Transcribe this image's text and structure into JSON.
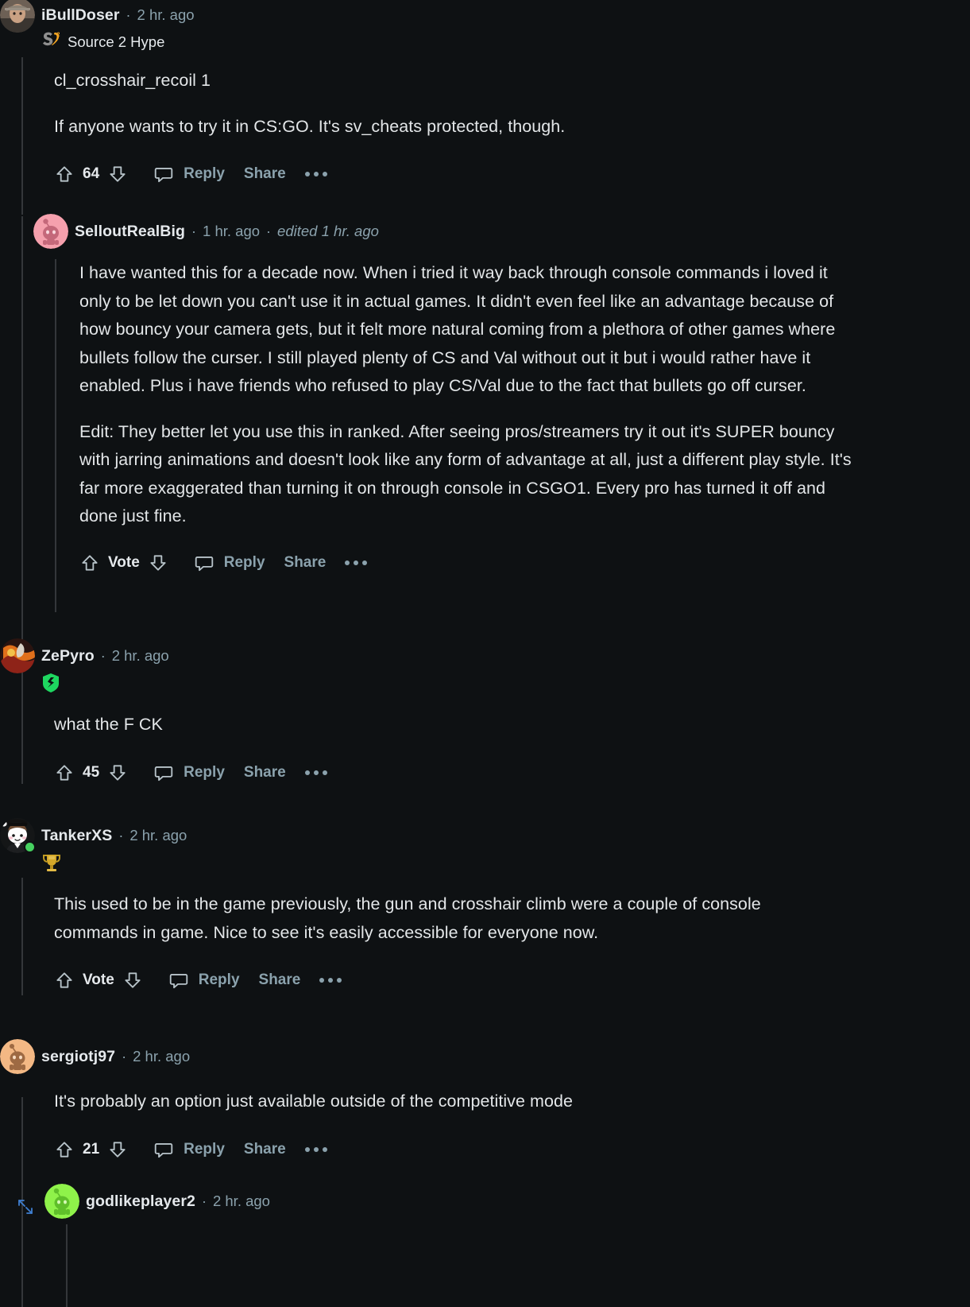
{
  "theme": {
    "background": "#0e1113",
    "text_primary": "#e3e6e8",
    "text_muted": "#8ba2ad",
    "rail": "#34373a",
    "flair_green": "#1ed760",
    "flair_gold": "#d4a829",
    "online_green": "#46d160",
    "expand_blue": "#3f7fd1"
  },
  "comments": [
    {
      "id": "c1",
      "author": "iBullDoser",
      "timestamp": "2 hr. ago",
      "separator": "·",
      "flair": {
        "text": "Source 2 Hype",
        "icon": "source2-logo-icon"
      },
      "avatar": {
        "name": "user-avatar-ibulldoser",
        "type": "photo"
      },
      "paragraphs": [
        "cl_crosshair_recoil 1",
        "If anyone wants to try it in CS:GO. It's sv_cheats protected, though."
      ],
      "actions": {
        "upvote_icon": "upvote-arrow-icon",
        "score": "64",
        "downvote_icon": "downvote-arrow-icon",
        "comment_icon": "comment-bubble-icon",
        "reply_label": "Reply",
        "share_label": "Share",
        "more_icon": "more-options-icon"
      }
    },
    {
      "id": "c2",
      "author": "SelloutRealBig",
      "timestamp": "1 hr. ago",
      "separator": "·",
      "edited": "edited 1 hr. ago",
      "avatar": {
        "name": "user-avatar-selloutrealbig",
        "type": "snoo-pink"
      },
      "paragraphs": [
        "I have wanted this for a decade now. When i tried it way back through console commands i loved it only to be let down you can't use it in actual games. It didn't even feel like an advantage because of how bouncy your camera gets, but it felt more natural coming from a plethora of other games where bullets follow the curser. I still played plenty of CS and Val without out it but i would rather have it enabled. Plus i have friends who refused to play CS/Val due to the fact that bullets go off curser.",
        "Edit: They better let you use this in ranked. After seeing pros/streamers try it out it's SUPER bouncy with jarring animations and doesn't look like any form of advantage at all, just a different play style. It's far more exaggerated than turning it on through console in CSGO1. Every pro has turned it off and done just fine."
      ],
      "actions": {
        "upvote_icon": "upvote-arrow-icon",
        "score": "Vote",
        "downvote_icon": "downvote-arrow-icon",
        "comment_icon": "comment-bubble-icon",
        "reply_label": "Reply",
        "share_label": "Share",
        "more_icon": "more-options-icon"
      }
    },
    {
      "id": "c3",
      "author": "ZePyro",
      "timestamp": "2 hr. ago",
      "separator": "·",
      "flair": {
        "text": "",
        "icon": "green-shield-badge-icon"
      },
      "avatar": {
        "name": "user-avatar-zepyro",
        "type": "photo-red"
      },
      "paragraphs": [
        "what the F  CK"
      ],
      "actions": {
        "upvote_icon": "upvote-arrow-icon",
        "score": "45",
        "downvote_icon": "downvote-arrow-icon",
        "comment_icon": "comment-bubble-icon",
        "reply_label": "Reply",
        "share_label": "Share",
        "more_icon": "more-options-icon"
      }
    },
    {
      "id": "c4",
      "author": "TankerXS",
      "timestamp": "2 hr. ago",
      "separator": "·",
      "flair": {
        "text": "",
        "icon": "gold-trophy-badge-icon"
      },
      "avatar": {
        "name": "user-avatar-tankerxs",
        "type": "snoo-cartoon",
        "online": true
      },
      "paragraphs": [
        "This used to be in the game previously, the gun and crosshair climb were a couple of console commands in game. Nice to see it's easily accessible for everyone now."
      ],
      "actions": {
        "upvote_icon": "upvote-arrow-icon",
        "score": "Vote",
        "downvote_icon": "downvote-arrow-icon",
        "comment_icon": "comment-bubble-icon",
        "reply_label": "Reply",
        "share_label": "Share",
        "more_icon": "more-options-icon"
      }
    },
    {
      "id": "c5",
      "author": "sergiotj97",
      "timestamp": "2 hr. ago",
      "separator": "·",
      "avatar": {
        "name": "user-avatar-sergiotj97",
        "type": "snoo-orange"
      },
      "paragraphs": [
        "It's probably an option just available outside of the competitive mode"
      ],
      "actions": {
        "upvote_icon": "upvote-arrow-icon",
        "score": "21",
        "downvote_icon": "downvote-arrow-icon",
        "comment_icon": "comment-bubble-icon",
        "reply_label": "Reply",
        "share_label": "Share",
        "more_icon": "more-options-icon"
      }
    },
    {
      "id": "c6",
      "author": "godlikeplayer2",
      "timestamp": "2 hr. ago",
      "separator": "·",
      "avatar": {
        "name": "user-avatar-godlikeplayer2",
        "type": "snoo-green"
      },
      "expand_icon": "expand-thread-icon"
    }
  ]
}
